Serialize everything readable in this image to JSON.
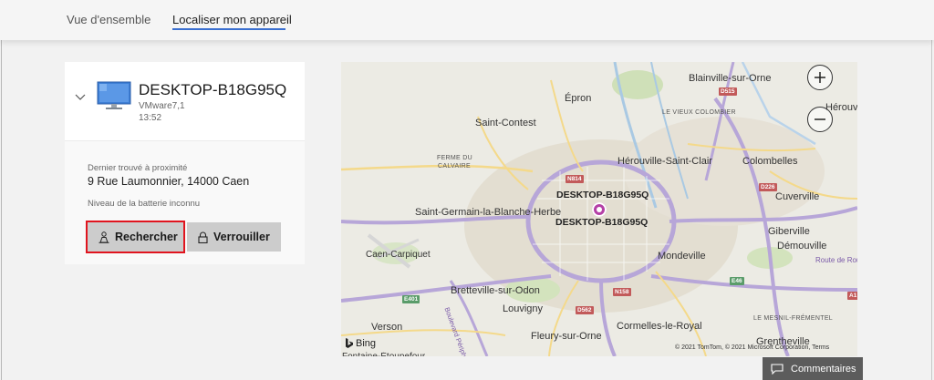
{
  "tabs": [
    {
      "label": "Vue d'ensemble",
      "active": false
    },
    {
      "label": "Localiser mon appareil",
      "active": true
    }
  ],
  "device": {
    "name": "DESKTOP-B18G95Q",
    "model": "VMware7,1",
    "time": "13:52",
    "found_label": "Dernier trouvé à proximité",
    "address": "9 Rue Laumonnier, 14000 Caen",
    "battery": "Niveau de la batterie inconnu",
    "icon": "desktop-pc-icon"
  },
  "actions": {
    "search_label": "Rechercher",
    "lock_label": "Verrouiller"
  },
  "map": {
    "places": {
      "blainville": "Blainville-sur-Orne",
      "epron": "Épron",
      "herouville": "Hérouvi",
      "saint_contest": "Saint-Contest",
      "vieux_colombier": "LE VIEUX COLOMBIER",
      "herouville_saint_clair": "Hérouville-Saint-Clair",
      "colombelles": "Colombelles",
      "ferme_calvaire_1": "FERME DU",
      "ferme_calvaire_2": "CALVAIRE",
      "cuverville": "Cuverville",
      "saint_germain": "Saint-Germain-la-Blanche-Herbe",
      "giberville": "Giberville",
      "demouville": "Démouville",
      "caen_carpiquet": "Caen-Carpiquet",
      "route_de_rou": "Route de Rou",
      "mondeville": "Mondeville",
      "bretteville": "Bretteville-sur-Odon",
      "louvigny": "Louvigny",
      "verson": "Verson",
      "cormelles": "Cormelles-le-Royal",
      "le_mesnil": "LE MESNIL-FRÉMENTEL",
      "grentheville": "Grentheville",
      "fleury": "Fleury-sur-Orne",
      "boulevard": "Boulevard Périph",
      "fontaine": "Fontaine-Étoupefour"
    },
    "road_badges": {
      "d515": "D515",
      "n814": "N814",
      "d226": "D226",
      "e46": "E46",
      "e401": "E401",
      "n158": "N158",
      "d562": "D562",
      "a13": "A1"
    },
    "pin_labels": [
      "DESKTOP-B18G95Q",
      "DESKTOP-B18G95Q"
    ],
    "provider": "Bing",
    "copyright": "© 2021 TomTom, © 2021 Microsoft Corporation, Terms",
    "zoom_in": "+",
    "zoom_out": "−",
    "colors": {
      "land": "#ecebe4",
      "urban": "#e2ddd0",
      "major_road": "#b7a6d8",
      "minor_road": "#f4d98a",
      "green": "#cfe0b8",
      "water": "#a9c9e3",
      "pin": "#b43fa6"
    }
  },
  "feedback": {
    "label": "Commentaires",
    "icon": "comment-icon"
  },
  "colors": {
    "accent": "#3a6fd0",
    "search_outline": "#e0141e",
    "button_bg": "#cccccc",
    "feedback_bg": "#5c5c5c"
  }
}
